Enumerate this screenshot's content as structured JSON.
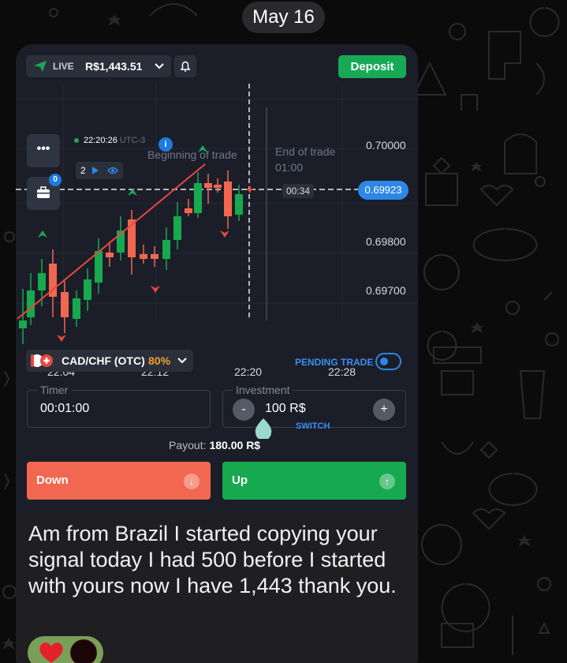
{
  "chat": {
    "date_label": "May 16",
    "message_text": "Am from Brazil I started copying your signal today I had 500 before I started with yours now I have 1,443 thank you.",
    "reaction_emoji": "red-heart"
  },
  "trading_app": {
    "account": {
      "mode": "LIVE",
      "balance": "R$1,443.51"
    },
    "deposit_label": "Deposit",
    "chart": {
      "clock": "22:20:26",
      "utc": "UTC-3",
      "trade_count": "2",
      "begin_label": "Beginning of trade",
      "end_label": "End of trade",
      "end_time": "01:00",
      "countdown": "00:34",
      "current_price": "0.69923",
      "price_ticks": [
        "0.70000",
        "0.69800",
        "0.69700"
      ],
      "time_ticks": [
        "22:04",
        "22:12",
        "22:20",
        "22:28"
      ],
      "case_badge": "0"
    },
    "asset": {
      "pair": "CAD/CHF (OTC)",
      "payout_pct": "80%"
    },
    "pending_trade_label": "PENDING TRADE",
    "timer": {
      "label": "Timer",
      "value": "00:01:00"
    },
    "investment": {
      "label": "Investment",
      "value": "100 R$",
      "minus": "-",
      "plus": "+",
      "switch_label": "SWITCH"
    },
    "payout": {
      "label": "Payout:",
      "value": "180.00 R$"
    },
    "down_label": "Down",
    "up_label": "Up",
    "colors": {
      "up": "#17a94f",
      "down": "#f2674f",
      "accent": "#2e86e6",
      "bg": "#1b1e28"
    }
  }
}
